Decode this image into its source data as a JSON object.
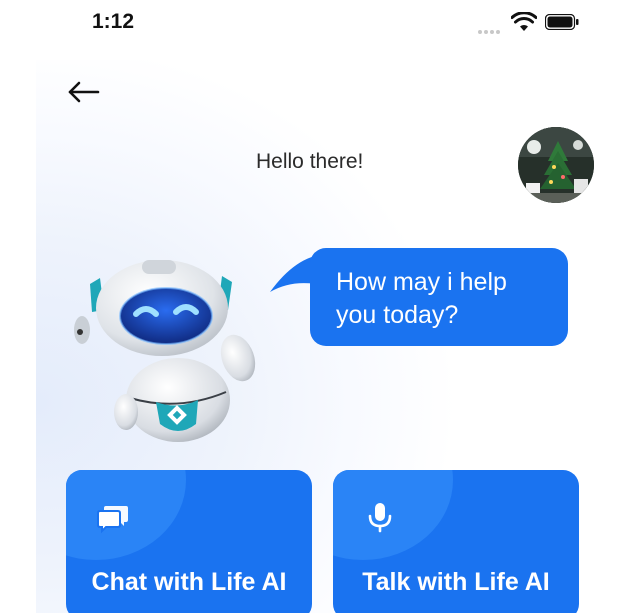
{
  "status_bar": {
    "time": "1:12"
  },
  "header": {
    "greeting": "Hello there!"
  },
  "assistant": {
    "message_line1": "How may i help",
    "message_line2": "you today?"
  },
  "actions": [
    {
      "label": "Chat with Life AI",
      "icon": "chat-bubbles-icon"
    },
    {
      "label": "Talk with Life AI",
      "icon": "microphone-icon"
    }
  ],
  "colors": {
    "primary": "#1a73f0",
    "primary_light": "#2a84f6",
    "background_tint": "#e4ecfb"
  }
}
